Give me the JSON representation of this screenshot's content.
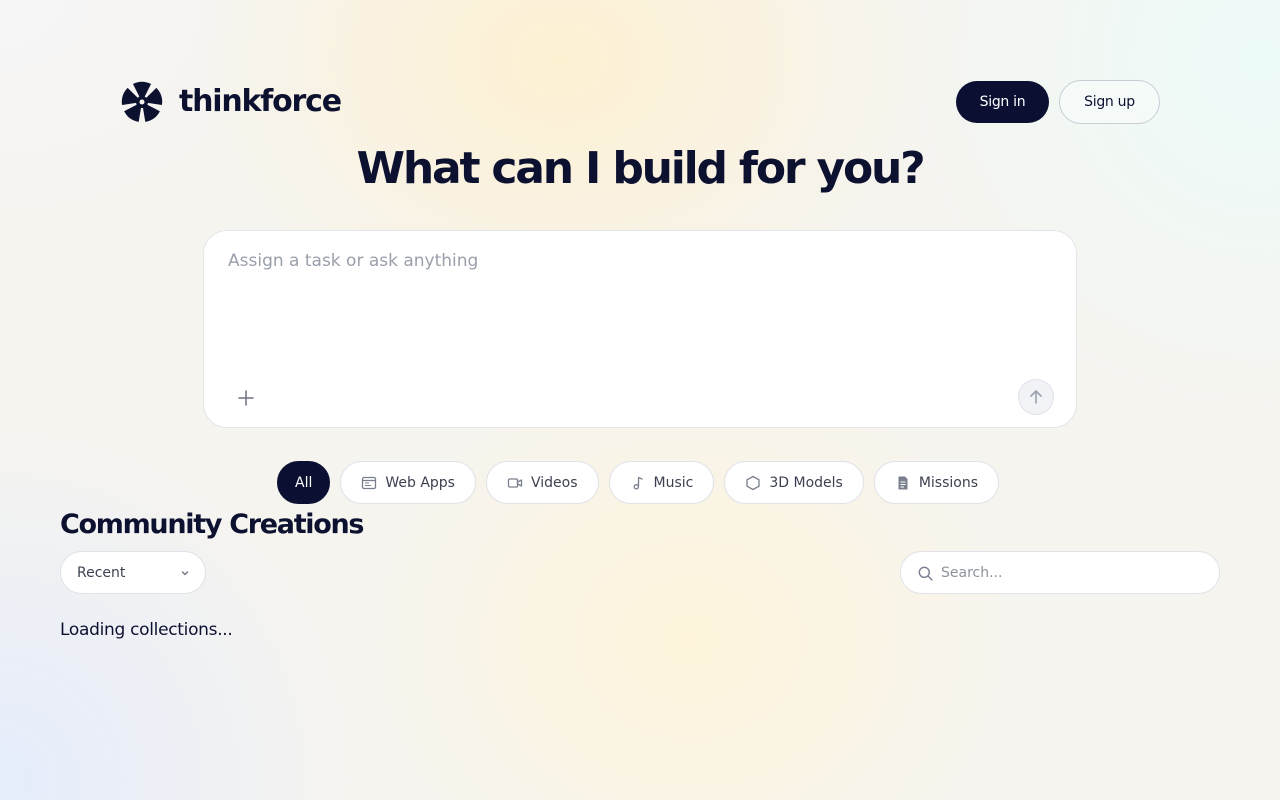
{
  "header": {
    "brand_name": "thinkforce",
    "sign_in_label": "Sign in",
    "sign_up_label": "Sign up"
  },
  "hero": {
    "title": "What can I build for you?"
  },
  "prompt": {
    "placeholder": "Assign a task or ask anything",
    "value": ""
  },
  "filters": {
    "active": "All",
    "items": [
      {
        "label": "All",
        "icon": ""
      },
      {
        "label": "Web Apps",
        "icon": "browser-window-icon"
      },
      {
        "label": "Videos",
        "icon": "video-camera-icon"
      },
      {
        "label": "Music",
        "icon": "music-note-icon"
      },
      {
        "label": "3D Models",
        "icon": "cube-icon"
      },
      {
        "label": "Missions",
        "icon": "document-icon"
      }
    ]
  },
  "community": {
    "title": "Community Creations",
    "sort_value": "Recent",
    "search_placeholder": "Search...",
    "status_text": "Loading collections..."
  },
  "colors": {
    "primary_dark": "#0b1033",
    "text": "#0d1130",
    "muted": "#9aa0ab",
    "border": "#e0e2e8"
  }
}
